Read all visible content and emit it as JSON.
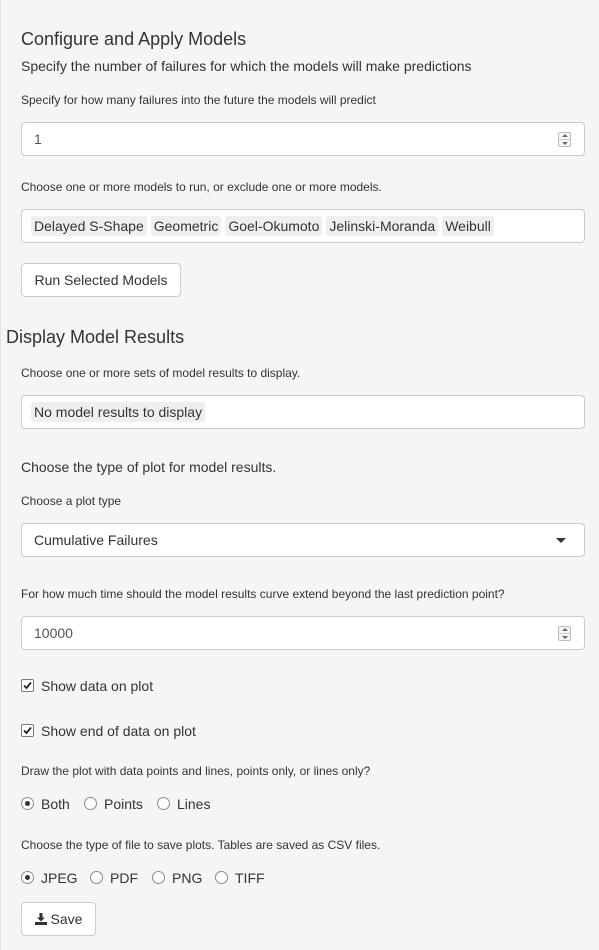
{
  "configure": {
    "title": "Configure and Apply Models",
    "subtitle": "Specify the number of failures for which the models will make predictions",
    "predict_label": "Specify for how many failures into the future the models will predict",
    "predict_value": "1",
    "models_label": "Choose one or more models to run, or exclude one or more models.",
    "models": [
      "Delayed S-Shape",
      "Geometric",
      "Goel-Okumoto",
      "Jelinski-Moranda",
      "Weibull"
    ],
    "run_button": "Run Selected Models"
  },
  "display": {
    "title": "Display Model Results",
    "results_label": "Choose one or more sets of model results to display.",
    "results_tag": "No model results to display",
    "plot_type_heading": "Choose the type of plot for model results.",
    "plot_type_label": "Choose a plot type",
    "plot_type_value": "Cumulative Failures",
    "extend_label": "For how much time should the model results curve extend beyond the last prediction point?",
    "extend_value": "10000",
    "show_data_label": "Show data on plot",
    "show_data_checked": true,
    "show_end_label": "Show end of data on plot",
    "show_end_checked": true,
    "draw_label": "Draw the plot with data points and lines, points only, or lines only?",
    "draw_options": [
      "Both",
      "Points",
      "Lines"
    ],
    "draw_selected": "Both",
    "file_label": "Choose the type of file to save plots. Tables are saved as CSV files.",
    "file_options": [
      "JPEG",
      "PDF",
      "PNG",
      "TIFF"
    ],
    "file_selected": "JPEG",
    "save_button": "Save",
    "save_icon": "download-icon"
  }
}
